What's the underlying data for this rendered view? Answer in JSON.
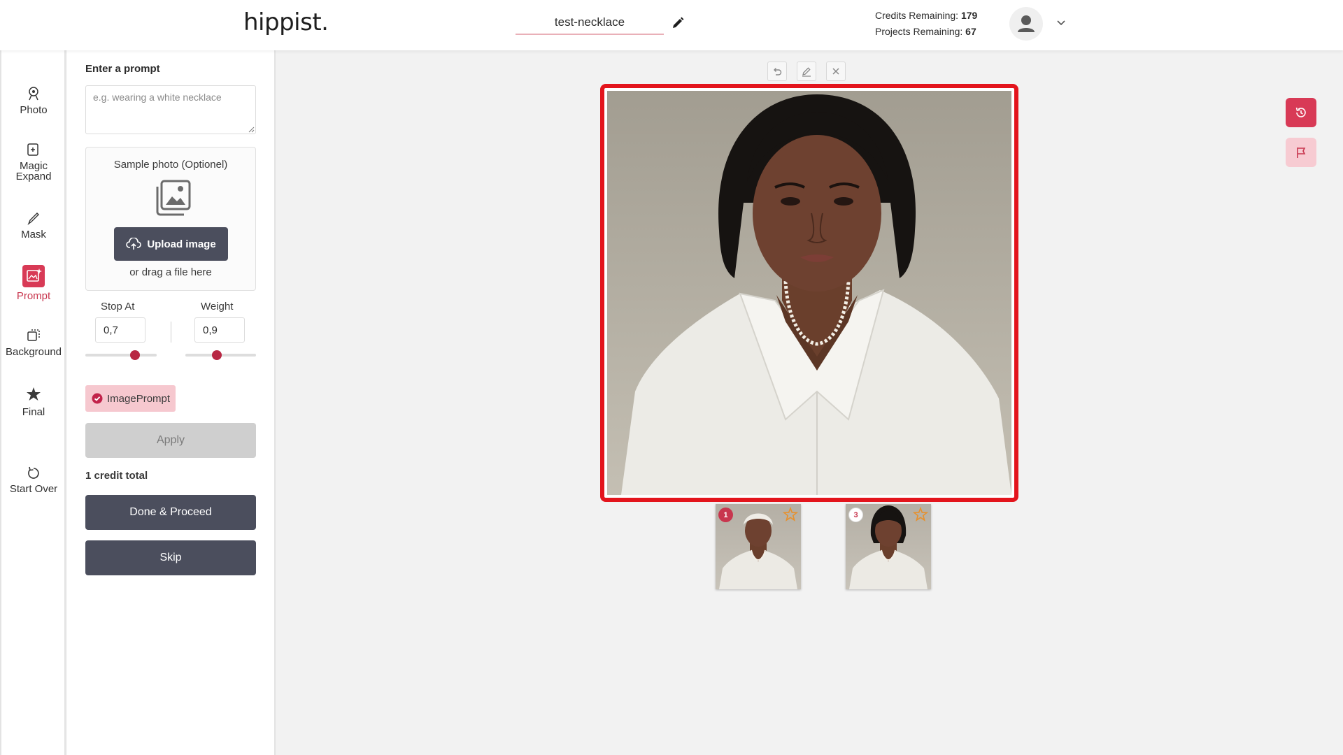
{
  "header": {
    "logo": "hippist.",
    "project_name": "test-necklace",
    "credits_label": "Credits Remaining:",
    "credits_value": "179",
    "projects_label": "Projects Remaining:",
    "projects_value": "67"
  },
  "rail": {
    "items": [
      {
        "label": "Photo",
        "icon": "photo-icon"
      },
      {
        "label": "Magic",
        "label2": "Expand",
        "icon": "magic-expand-icon"
      },
      {
        "label": "Mask",
        "icon": "mask-brush-icon"
      },
      {
        "label": "Prompt",
        "icon": "prompt-icon",
        "active": true
      },
      {
        "label": "Background",
        "icon": "background-icon"
      },
      {
        "label": "Final",
        "icon": "final-star-icon"
      },
      {
        "label": "Start Over",
        "icon": "start-over-icon"
      }
    ]
  },
  "panel": {
    "prompt_label": "Enter a prompt",
    "prompt_placeholder": "e.g. wearing a white necklace",
    "prompt_value": "",
    "sample_title": "Sample photo (Optionel)",
    "upload_label": "Upload image",
    "drag_text": "or drag a file here",
    "stop_at_label": "Stop At",
    "stop_at_value": "0,7",
    "stop_at_level": 0.7,
    "weight_label": "Weight",
    "weight_value": "0,9",
    "weight_level": 0.45,
    "chip_label": "ImagePrompt",
    "apply_label": "Apply",
    "credit_total": "1 credit total",
    "done_label": "Done & Proceed",
    "skip_label": "Skip"
  },
  "canvas": {
    "tools": [
      "undo-icon",
      "edit-icon",
      "close-icon"
    ],
    "thumbnails": [
      {
        "badge": "1",
        "starred": false
      },
      {
        "badge": "3",
        "starred": false
      }
    ]
  },
  "colors": {
    "accent": "#c8364e",
    "frame": "#e3141c",
    "dark_button": "#4b4e5d",
    "chip_bg": "#f6c8cf"
  }
}
